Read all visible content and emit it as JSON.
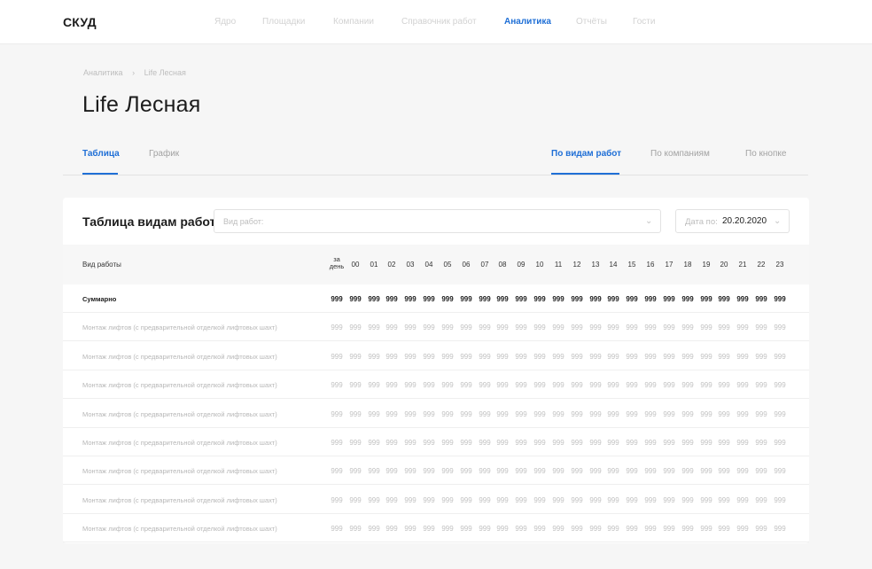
{
  "app": {
    "brand": "СКУД"
  },
  "topnav": [
    "Ядро",
    "Площадки",
    "Компании",
    "Справочник работ",
    "Аналитика",
    "Отчёты",
    "Гости"
  ],
  "breadcrumb": {
    "parent": "Аналитика",
    "separator": "›",
    "current": "Life Лесная"
  },
  "page_title": "Life Лесная",
  "view_tabs": [
    {
      "label": "Таблица",
      "active": true
    },
    {
      "label": "График",
      "active": false
    }
  ],
  "group_tabs": [
    {
      "label": "По видам работ",
      "active": true
    },
    {
      "label": "По компаниям",
      "active": false
    },
    {
      "label": "По кнопке",
      "active": false
    }
  ],
  "card": {
    "title": "Таблица видам работ",
    "work_select_placeholder": "Вид работ:",
    "date_label": "Дата по:",
    "date_value": "20.20.2020",
    "chevron_icon": "chevron-down-icon"
  },
  "table": {
    "label_header": "Вид работы",
    "day_header": [
      "за",
      "день"
    ],
    "hours": [
      "00",
      "01",
      "02",
      "03",
      "04",
      "05",
      "06",
      "07",
      "08",
      "09",
      "10",
      "11",
      "12",
      "13",
      "14",
      "15",
      "16",
      "17",
      "18",
      "19",
      "20",
      "21",
      "22",
      "23"
    ],
    "rows": [
      {
        "label": "Суммарно",
        "summary": true,
        "values": [
          "999",
          "999",
          "999",
          "999",
          "999",
          "999",
          "999",
          "999",
          "999",
          "999",
          "999",
          "999",
          "999",
          "999",
          "999",
          "999",
          "999",
          "999",
          "999",
          "999",
          "999",
          "999",
          "999",
          "999",
          "999"
        ]
      },
      {
        "label": "Монтаж лифтов (с предварительной отделкой лифтовых шахт)",
        "summary": false,
        "values": [
          "999",
          "999",
          "999",
          "999",
          "999",
          "999",
          "999",
          "999",
          "999",
          "999",
          "999",
          "999",
          "999",
          "999",
          "999",
          "999",
          "999",
          "999",
          "999",
          "999",
          "999",
          "999",
          "999",
          "999",
          "999"
        ]
      },
      {
        "label": "Монтаж лифтов (с предварительной отделкой лифтовых шахт)",
        "summary": false,
        "values": [
          "999",
          "999",
          "999",
          "999",
          "999",
          "999",
          "999",
          "999",
          "999",
          "999",
          "999",
          "999",
          "999",
          "999",
          "999",
          "999",
          "999",
          "999",
          "999",
          "999",
          "999",
          "999",
          "999",
          "999",
          "999"
        ]
      },
      {
        "label": "Монтаж лифтов (с предварительной отделкой лифтовых шахт)",
        "summary": false,
        "values": [
          "999",
          "999",
          "999",
          "999",
          "999",
          "999",
          "999",
          "999",
          "999",
          "999",
          "999",
          "999",
          "999",
          "999",
          "999",
          "999",
          "999",
          "999",
          "999",
          "999",
          "999",
          "999",
          "999",
          "999",
          "999"
        ]
      },
      {
        "label": "Монтаж лифтов (с предварительной отделкой лифтовых шахт)",
        "summary": false,
        "values": [
          "999",
          "999",
          "999",
          "999",
          "999",
          "999",
          "999",
          "999",
          "999",
          "999",
          "999",
          "999",
          "999",
          "999",
          "999",
          "999",
          "999",
          "999",
          "999",
          "999",
          "999",
          "999",
          "999",
          "999",
          "999"
        ]
      },
      {
        "label": "Монтаж лифтов (с предварительной отделкой лифтовых шахт)",
        "summary": false,
        "values": [
          "999",
          "999",
          "999",
          "999",
          "999",
          "999",
          "999",
          "999",
          "999",
          "999",
          "999",
          "999",
          "999",
          "999",
          "999",
          "999",
          "999",
          "999",
          "999",
          "999",
          "999",
          "999",
          "999",
          "999",
          "999"
        ]
      },
      {
        "label": "Монтаж лифтов (с предварительной отделкой лифтовых шахт)",
        "summary": false,
        "values": [
          "999",
          "999",
          "999",
          "999",
          "999",
          "999",
          "999",
          "999",
          "999",
          "999",
          "999",
          "999",
          "999",
          "999",
          "999",
          "999",
          "999",
          "999",
          "999",
          "999",
          "999",
          "999",
          "999",
          "999",
          "999"
        ]
      },
      {
        "label": "Монтаж лифтов (с предварительной отделкой лифтовых шахт)",
        "summary": false,
        "values": [
          "999",
          "999",
          "999",
          "999",
          "999",
          "999",
          "999",
          "999",
          "999",
          "999",
          "999",
          "999",
          "999",
          "999",
          "999",
          "999",
          "999",
          "999",
          "999",
          "999",
          "999",
          "999",
          "999",
          "999",
          "999"
        ]
      },
      {
        "label": "Монтаж лифтов (с предварительной отделкой лифтовых шахт)",
        "summary": false,
        "values": [
          "999",
          "999",
          "999",
          "999",
          "999",
          "999",
          "999",
          "999",
          "999",
          "999",
          "999",
          "999",
          "999",
          "999",
          "999",
          "999",
          "999",
          "999",
          "999",
          "999",
          "999",
          "999",
          "999",
          "999",
          "999"
        ]
      }
    ]
  }
}
